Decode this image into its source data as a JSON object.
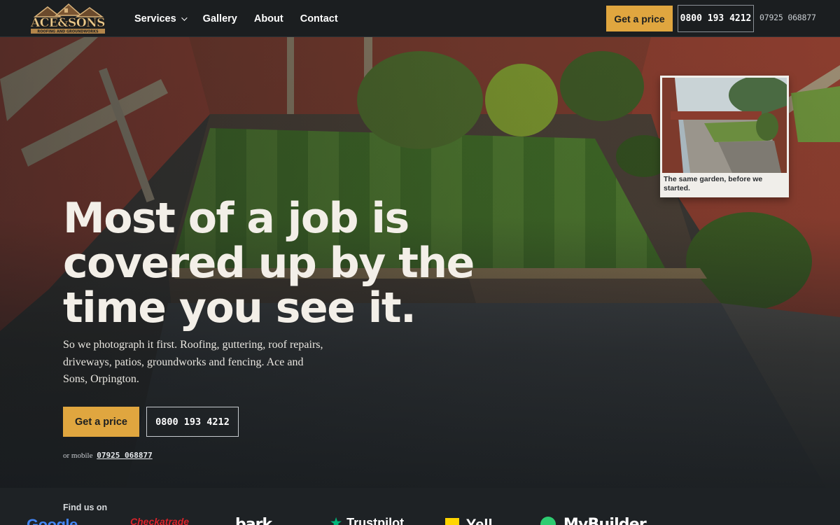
{
  "header": {
    "logo_text": "ACE&SONS",
    "logo_subtext": "ROOFING AND GROUNDWORKS",
    "nav": [
      {
        "label": "Services"
      },
      {
        "label": "Gallery"
      },
      {
        "label": "About"
      },
      {
        "label": "Contact"
      }
    ],
    "cta_label": "Get a price",
    "phone": "0800 193 4212",
    "mobile": "07925 068877"
  },
  "hero": {
    "headline": "Most of a job is covered up by the time you see it.",
    "subcopy": "So we photograph it first. Roofing, guttering, roof repairs, driveways, patios, groundworks and fencing. Ace and Sons, Orpington.",
    "primary_cta": "Get a price",
    "phone_cta": "0800 193 4212",
    "mobile_prefix": "or mobile",
    "mobile_number": "07925 068877",
    "before_caption": "The same garden, before we started."
  },
  "find_us": {
    "title": "Find us on",
    "brands": [
      {
        "name": "Google",
        "icon": "google-logo",
        "color": "#4285f4"
      },
      {
        "name": "Checkatrade",
        "icon": "checkatrade-logo",
        "color": "#d8232a"
      },
      {
        "name": "bark",
        "icon": "bark-logo",
        "color": "#ffffff"
      },
      {
        "name": "Trustpilot",
        "icon": "trustpilot-logo",
        "color": "#00b67a"
      },
      {
        "name": "Yell",
        "icon": "yell-logo",
        "color": "#ffd500"
      },
      {
        "name": "MyBuilder",
        "icon": "mybuilder-logo",
        "color": "#2ecc71"
      }
    ]
  },
  "colors": {
    "accent": "#e0a63f",
    "background": "#1b1f22"
  }
}
